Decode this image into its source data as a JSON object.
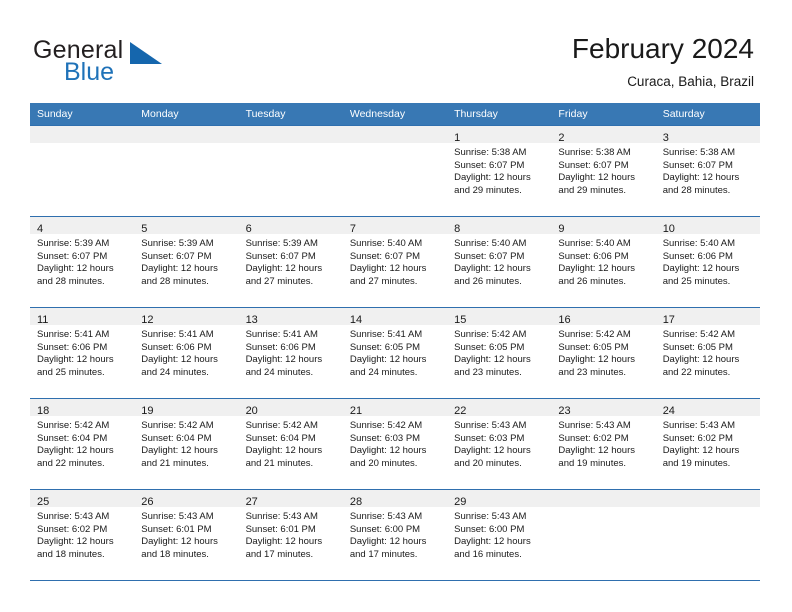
{
  "logo": {
    "text_primary": "General",
    "text_secondary": "Blue",
    "icon": "triangle-flag-icon",
    "color_primary": "#231f20",
    "color_secondary": "#1f72b8"
  },
  "header": {
    "month_title": "February 2024",
    "location": "Curaca, Bahia, Brazil"
  },
  "theme": {
    "header_row_bg": "#3878b4",
    "header_row_text": "#ffffff",
    "daynum_band_bg": "#f0f0f0",
    "row_border": "#2f6fae"
  },
  "calendar": {
    "weekday_headers": [
      "Sunday",
      "Monday",
      "Tuesday",
      "Wednesday",
      "Thursday",
      "Friday",
      "Saturday"
    ],
    "weeks": [
      [
        {
          "day": "",
          "lines": [],
          "empty": true
        },
        {
          "day": "",
          "lines": [],
          "empty": true
        },
        {
          "day": "",
          "lines": [],
          "empty": true
        },
        {
          "day": "",
          "lines": [],
          "empty": true
        },
        {
          "day": "1",
          "lines": [
            "Sunrise: 5:38 AM",
            "Sunset: 6:07 PM",
            "Daylight: 12 hours",
            "and 29 minutes."
          ],
          "empty": false
        },
        {
          "day": "2",
          "lines": [
            "Sunrise: 5:38 AM",
            "Sunset: 6:07 PM",
            "Daylight: 12 hours",
            "and 29 minutes."
          ],
          "empty": false
        },
        {
          "day": "3",
          "lines": [
            "Sunrise: 5:38 AM",
            "Sunset: 6:07 PM",
            "Daylight: 12 hours",
            "and 28 minutes."
          ],
          "empty": false
        }
      ],
      [
        {
          "day": "4",
          "lines": [
            "Sunrise: 5:39 AM",
            "Sunset: 6:07 PM",
            "Daylight: 12 hours",
            "and 28 minutes."
          ],
          "empty": false
        },
        {
          "day": "5",
          "lines": [
            "Sunrise: 5:39 AM",
            "Sunset: 6:07 PM",
            "Daylight: 12 hours",
            "and 28 minutes."
          ],
          "empty": false
        },
        {
          "day": "6",
          "lines": [
            "Sunrise: 5:39 AM",
            "Sunset: 6:07 PM",
            "Daylight: 12 hours",
            "and 27 minutes."
          ],
          "empty": false
        },
        {
          "day": "7",
          "lines": [
            "Sunrise: 5:40 AM",
            "Sunset: 6:07 PM",
            "Daylight: 12 hours",
            "and 27 minutes."
          ],
          "empty": false
        },
        {
          "day": "8",
          "lines": [
            "Sunrise: 5:40 AM",
            "Sunset: 6:07 PM",
            "Daylight: 12 hours",
            "and 26 minutes."
          ],
          "empty": false
        },
        {
          "day": "9",
          "lines": [
            "Sunrise: 5:40 AM",
            "Sunset: 6:06 PM",
            "Daylight: 12 hours",
            "and 26 minutes."
          ],
          "empty": false
        },
        {
          "day": "10",
          "lines": [
            "Sunrise: 5:40 AM",
            "Sunset: 6:06 PM",
            "Daylight: 12 hours",
            "and 25 minutes."
          ],
          "empty": false
        }
      ],
      [
        {
          "day": "11",
          "lines": [
            "Sunrise: 5:41 AM",
            "Sunset: 6:06 PM",
            "Daylight: 12 hours",
            "and 25 minutes."
          ],
          "empty": false
        },
        {
          "day": "12",
          "lines": [
            "Sunrise: 5:41 AM",
            "Sunset: 6:06 PM",
            "Daylight: 12 hours",
            "and 24 minutes."
          ],
          "empty": false
        },
        {
          "day": "13",
          "lines": [
            "Sunrise: 5:41 AM",
            "Sunset: 6:06 PM",
            "Daylight: 12 hours",
            "and 24 minutes."
          ],
          "empty": false
        },
        {
          "day": "14",
          "lines": [
            "Sunrise: 5:41 AM",
            "Sunset: 6:05 PM",
            "Daylight: 12 hours",
            "and 24 minutes."
          ],
          "empty": false
        },
        {
          "day": "15",
          "lines": [
            "Sunrise: 5:42 AM",
            "Sunset: 6:05 PM",
            "Daylight: 12 hours",
            "and 23 minutes."
          ],
          "empty": false
        },
        {
          "day": "16",
          "lines": [
            "Sunrise: 5:42 AM",
            "Sunset: 6:05 PM",
            "Daylight: 12 hours",
            "and 23 minutes."
          ],
          "empty": false
        },
        {
          "day": "17",
          "lines": [
            "Sunrise: 5:42 AM",
            "Sunset: 6:05 PM",
            "Daylight: 12 hours",
            "and 22 minutes."
          ],
          "empty": false
        }
      ],
      [
        {
          "day": "18",
          "lines": [
            "Sunrise: 5:42 AM",
            "Sunset: 6:04 PM",
            "Daylight: 12 hours",
            "and 22 minutes."
          ],
          "empty": false
        },
        {
          "day": "19",
          "lines": [
            "Sunrise: 5:42 AM",
            "Sunset: 6:04 PM",
            "Daylight: 12 hours",
            "and 21 minutes."
          ],
          "empty": false
        },
        {
          "day": "20",
          "lines": [
            "Sunrise: 5:42 AM",
            "Sunset: 6:04 PM",
            "Daylight: 12 hours",
            "and 21 minutes."
          ],
          "empty": false
        },
        {
          "day": "21",
          "lines": [
            "Sunrise: 5:42 AM",
            "Sunset: 6:03 PM",
            "Daylight: 12 hours",
            "and 20 minutes."
          ],
          "empty": false
        },
        {
          "day": "22",
          "lines": [
            "Sunrise: 5:43 AM",
            "Sunset: 6:03 PM",
            "Daylight: 12 hours",
            "and 20 minutes."
          ],
          "empty": false
        },
        {
          "day": "23",
          "lines": [
            "Sunrise: 5:43 AM",
            "Sunset: 6:02 PM",
            "Daylight: 12 hours",
            "and 19 minutes."
          ],
          "empty": false
        },
        {
          "day": "24",
          "lines": [
            "Sunrise: 5:43 AM",
            "Sunset: 6:02 PM",
            "Daylight: 12 hours",
            "and 19 minutes."
          ],
          "empty": false
        }
      ],
      [
        {
          "day": "25",
          "lines": [
            "Sunrise: 5:43 AM",
            "Sunset: 6:02 PM",
            "Daylight: 12 hours",
            "and 18 minutes."
          ],
          "empty": false
        },
        {
          "day": "26",
          "lines": [
            "Sunrise: 5:43 AM",
            "Sunset: 6:01 PM",
            "Daylight: 12 hours",
            "and 18 minutes."
          ],
          "empty": false
        },
        {
          "day": "27",
          "lines": [
            "Sunrise: 5:43 AM",
            "Sunset: 6:01 PM",
            "Daylight: 12 hours",
            "and 17 minutes."
          ],
          "empty": false
        },
        {
          "day": "28",
          "lines": [
            "Sunrise: 5:43 AM",
            "Sunset: 6:00 PM",
            "Daylight: 12 hours",
            "and 17 minutes."
          ],
          "empty": false
        },
        {
          "day": "29",
          "lines": [
            "Sunrise: 5:43 AM",
            "Sunset: 6:00 PM",
            "Daylight: 12 hours",
            "and 16 minutes."
          ],
          "empty": false
        },
        {
          "day": "",
          "lines": [],
          "empty": true
        },
        {
          "day": "",
          "lines": [],
          "empty": true
        }
      ]
    ]
  }
}
